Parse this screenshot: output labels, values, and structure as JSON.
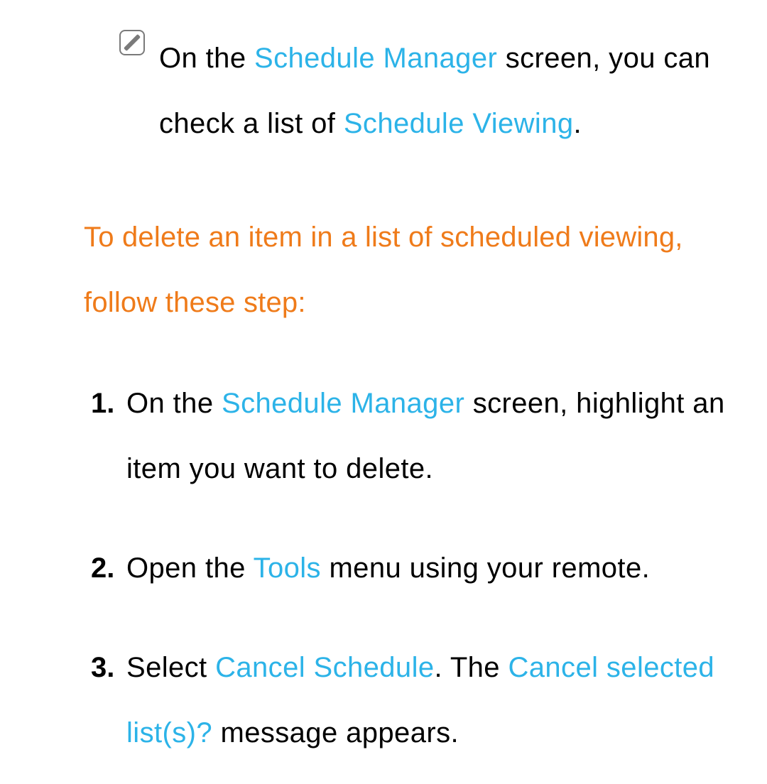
{
  "note": {
    "t1": "On the ",
    "h1": "Schedule Manager",
    "t2": " screen, you can check a list of ",
    "h2": "Schedule Viewing",
    "t3": "."
  },
  "heading": "To delete an item in a list of scheduled viewing, follow these step:",
  "steps": [
    {
      "num": "1.",
      "segments": [
        {
          "text": "On the "
        },
        {
          "text": "Schedule Manager",
          "hl": true
        },
        {
          "text": " screen, highlight an item you want to delete."
        }
      ]
    },
    {
      "num": "2.",
      "segments": [
        {
          "text": "Open the "
        },
        {
          "text": "Tools",
          "hl": true
        },
        {
          "text": " menu using your remote."
        }
      ]
    },
    {
      "num": "3.",
      "segments": [
        {
          "text": "Select "
        },
        {
          "text": "Cancel Schedule",
          "hl": true
        },
        {
          "text": ". The "
        },
        {
          "text": "Cancel selected list(s)?",
          "hl": true
        },
        {
          "text": " message appears."
        }
      ]
    }
  ]
}
